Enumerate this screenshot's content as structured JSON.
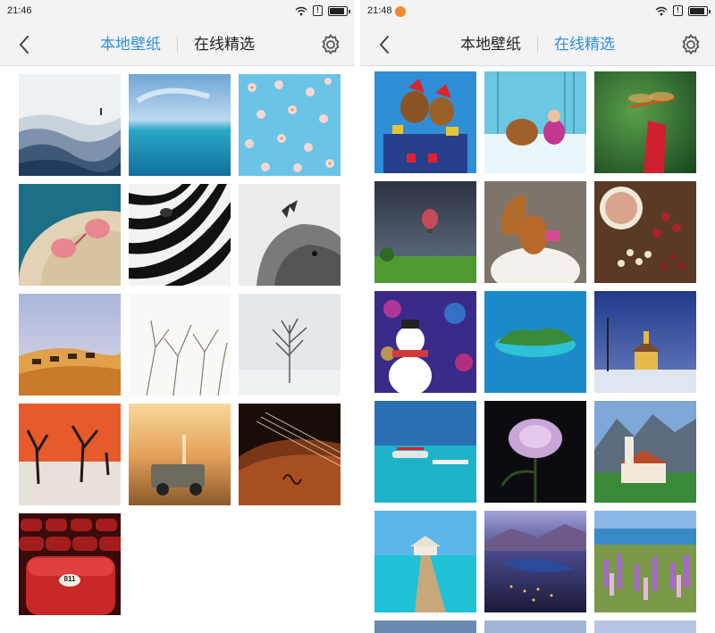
{
  "left_screen": {
    "status": {
      "time": "21:46",
      "alert_glyph": "!"
    },
    "nav": {
      "tab_local": "本地壁纸",
      "tab_online": "在线精选",
      "active_tab": "local"
    },
    "wallpapers": [
      {
        "name": "ocean-wave-surfer"
      },
      {
        "name": "blue-sea-horizon"
      },
      {
        "name": "flowers-on-blue"
      },
      {
        "name": "pink-sunglasses-straw-hat"
      },
      {
        "name": "zebra-closeup"
      },
      {
        "name": "cat-with-butterfly"
      },
      {
        "name": "desert-camels"
      },
      {
        "name": "snowy-branches"
      },
      {
        "name": "misty-tree"
      },
      {
        "name": "dead-trees-desert"
      },
      {
        "name": "jeep-sunset-field"
      },
      {
        "name": "violin-closeup"
      },
      {
        "name": "red-theater-seats",
        "seat_label": "811"
      }
    ]
  },
  "right_screen": {
    "status": {
      "time": "21:48",
      "alert_glyph": "!"
    },
    "nav": {
      "tab_local": "本地壁纸",
      "tab_online": "在线精选",
      "active_tab": "online"
    },
    "wallpapers": [
      {
        "name": "christmas-reindeer-gifts"
      },
      {
        "name": "reindeer-girl-snow"
      },
      {
        "name": "dragonfly-red-flower"
      },
      {
        "name": "hot-air-balloon-field"
      },
      {
        "name": "squirrel-camera"
      },
      {
        "name": "food-beans-spices"
      },
      {
        "name": "snowman-bokeh"
      },
      {
        "name": "island-blue-sea"
      },
      {
        "name": "winter-chapel-night"
      },
      {
        "name": "seaplane-turquoise"
      },
      {
        "name": "pink-peony-dark"
      },
      {
        "name": "alpine-castle-church"
      },
      {
        "name": "pier-tropical-sea"
      },
      {
        "name": "lake-city-dusk"
      },
      {
        "name": "lupine-lake-field"
      },
      {
        "name": "partial-row-1"
      },
      {
        "name": "partial-row-2"
      },
      {
        "name": "partial-row-3"
      }
    ]
  },
  "colors": {
    "accent": "#2f8fe0",
    "bar_bg": "#f3f3f3"
  }
}
